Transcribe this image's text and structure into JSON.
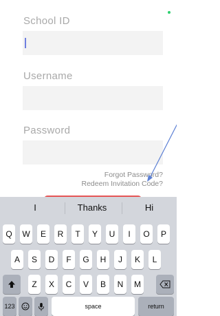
{
  "form": {
    "school_id_label": "School ID",
    "username_label": "Username",
    "password_label": "Password",
    "forgot_password": "Forgot Password?",
    "redeem_invitation": "Redeem Invitation Code?"
  },
  "keyboard": {
    "suggestions": [
      "I",
      "Thanks",
      "Hi"
    ],
    "row1": [
      "Q",
      "W",
      "E",
      "R",
      "T",
      "Y",
      "U",
      "I",
      "O",
      "P"
    ],
    "row2": [
      "A",
      "S",
      "D",
      "F",
      "G",
      "H",
      "J",
      "K",
      "L"
    ],
    "row3": [
      "Z",
      "X",
      "C",
      "V",
      "B",
      "N",
      "M"
    ],
    "numbers_key": "123",
    "space_key": "space",
    "return_key": "return"
  },
  "colors": {
    "accent": "#e55454",
    "annotation": "#5b7fd4",
    "status": "#2ed06f"
  }
}
